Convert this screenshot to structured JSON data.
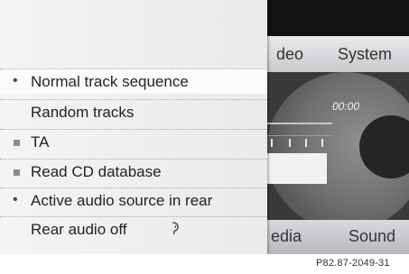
{
  "tabs": {
    "video_partial": "deo",
    "system": "System"
  },
  "bottom": {
    "media_partial": "edia",
    "sound": "Sound"
  },
  "player": {
    "time": "00:00"
  },
  "menu": {
    "items": [
      {
        "label": "Normal track sequence",
        "indicator": "dot",
        "selected": true
      },
      {
        "label": "Random tracks",
        "indicator": "none"
      },
      {
        "label": "TA",
        "indicator": "square"
      },
      {
        "label": "Read CD database",
        "indicator": "square"
      },
      {
        "label": "Active audio source in rear",
        "indicator": "dot"
      },
      {
        "label": "Rear audio off",
        "indicator": "none",
        "icon": "rear-audio-icon"
      }
    ],
    "dot_glyph": "•"
  },
  "figure_code": "P82.87-2049-31"
}
